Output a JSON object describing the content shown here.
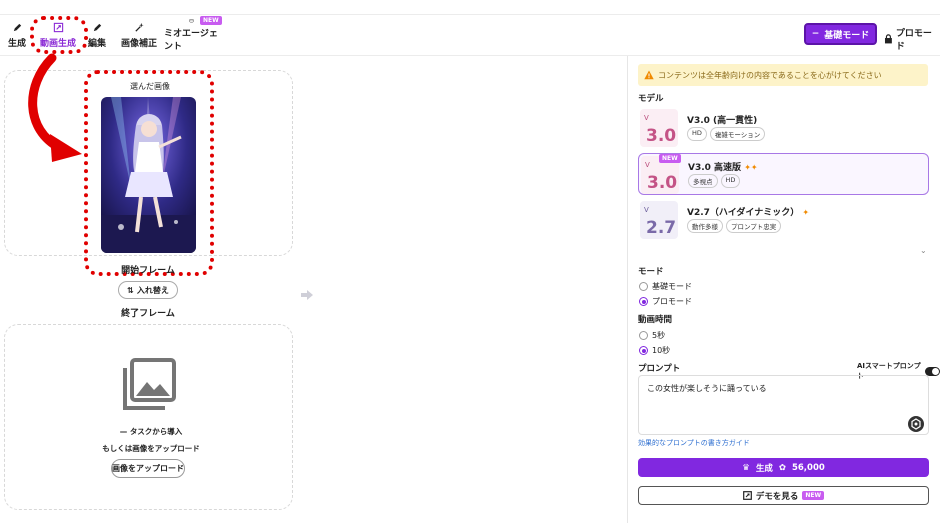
{
  "nav": {
    "tabs": [
      {
        "label": "生成",
        "icon": "pencil-icon"
      },
      {
        "label": "動画生成",
        "icon": "video-edit-icon"
      },
      {
        "label": "編集",
        "icon": "pencil-icon"
      },
      {
        "label": "画像補正",
        "icon": "sparkle-tool-icon"
      },
      {
        "label": "ミオエージェント",
        "icon": "agent-icon"
      }
    ],
    "new_badge": "NEW"
  },
  "header": {
    "mode_button": "基礎モード",
    "pro_button": "プロモード"
  },
  "left": {
    "selected_image_label": "選んだ画像",
    "start_frame_label": "開始フレーム",
    "swap_button": "入れ替え",
    "end_frame_label": "終了フレーム",
    "import_text": "タスクから導入",
    "or_upload_text": "もしくは画像をアップロード",
    "upload_button": "画像をアップロード"
  },
  "right": {
    "warning": "コンテンツは全年齢向けの内容であることを心がけてください",
    "model_title": "モデル",
    "models": [
      {
        "name": "V3.0 (高一貫性)",
        "tags": [
          "HD",
          "複雑モーション"
        ],
        "thumb": "3.0",
        "badge": ""
      },
      {
        "name": "V3.0 高速版",
        "tags": [
          "多視点",
          "HD"
        ],
        "thumb": "3.0",
        "badge": "NEW"
      },
      {
        "name": "V2.7（ハイダイナミック）",
        "tags": [
          "動作多様",
          "プロンプト忠実"
        ],
        "thumb": "2.7",
        "badge": ""
      }
    ],
    "mode_title": "モード",
    "mode_options": [
      "基礎モード",
      "プロモード"
    ],
    "mode_selected": "プロモード",
    "duration_title": "動画時間",
    "duration_options": [
      "5秒",
      "10秒"
    ],
    "duration_selected": "10秒",
    "prompt_title": "プロンプト",
    "ai_prompt_label": "AIスマートプロンプト",
    "ai_prompt_on": true,
    "prompt_value": "この女性が楽しそうに踊っている",
    "guide_link": "効果的なプロンプトの書き方ガイド",
    "generate_button": "生成",
    "cost": "56,000",
    "demo_button": "デモを見る",
    "demo_badge": "NEW"
  },
  "colors": {
    "accent": "#8128e0",
    "highlight": "#e00000",
    "warning_bg": "#fdf3c9"
  }
}
